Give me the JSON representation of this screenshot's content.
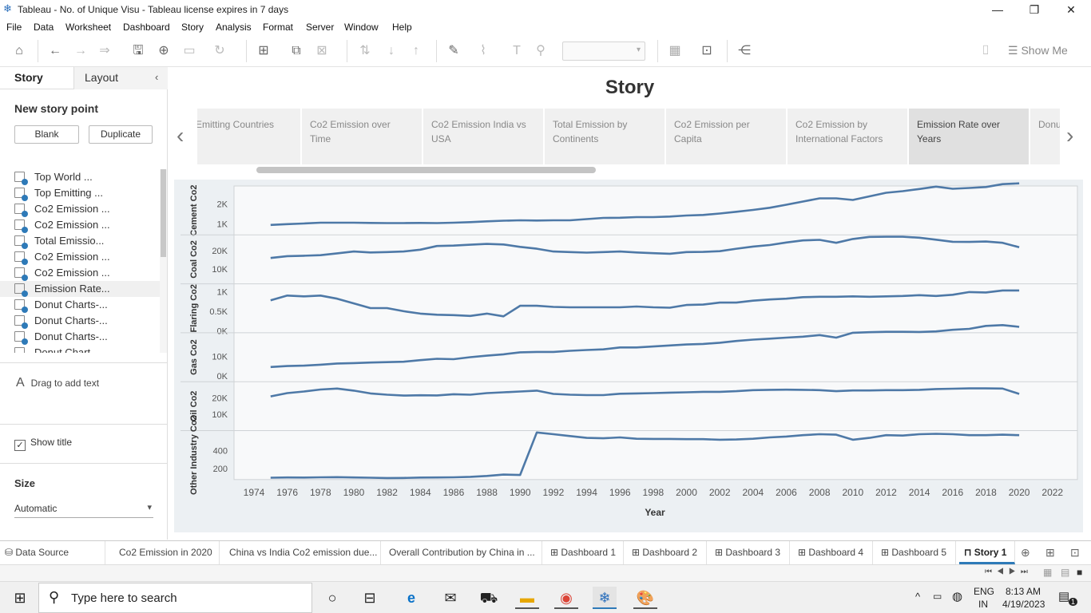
{
  "window": {
    "title": "Tableau - No. of Unique Visu - Tableau license expires in 7 days"
  },
  "menu": [
    "File",
    "Data",
    "Worksheet",
    "Dashboard",
    "Story",
    "Analysis",
    "Format",
    "Server",
    "Window",
    "Help"
  ],
  "toolbar": {
    "show_me": "Show Me"
  },
  "sidebar": {
    "tab_story": "Story",
    "tab_layout": "Layout",
    "new_story_point": "New story point",
    "blank_button": "Blank",
    "duplicate_button": "Duplicate",
    "sheets": [
      "Top World ...",
      "Top Emitting ...",
      "Co2 Emission ...",
      "Co2 Emission ...",
      "Total Emissio...",
      "Co2 Emission ...",
      "Co2 Emission ...",
      "Emission Rate...",
      "Donut Charts-...",
      "Donut Charts-...",
      "Donut Charts-...",
      "Donut Chart..."
    ],
    "drag_text": "Drag to add text",
    "show_title": "Show title",
    "size_label": "Size",
    "size_value": "Automatic"
  },
  "story": {
    "title": "Story",
    "points": [
      "Emitting Countries",
      "Co2 Emission over Time",
      "Co2 Emission India vs USA",
      "Total Emission by Continents",
      "Co2 Emission per Capita",
      "Co2 Emission by International Factors",
      "Emission Rate over Years",
      "Donut"
    ],
    "active_point": "Emission Rate over Years"
  },
  "chart_data": {
    "type": "line",
    "xlabel": "Year",
    "x_ticks": [
      "1974",
      "1976",
      "1978",
      "1980",
      "1982",
      "1984",
      "1986",
      "1988",
      "1990",
      "1992",
      "1994",
      "1996",
      "1998",
      "2000",
      "2002",
      "2004",
      "2006",
      "2008",
      "2010",
      "2012",
      "2014",
      "2016",
      "2018",
      "2020",
      "2022"
    ],
    "xlim": [
      1972.8,
      2023.5
    ],
    "years": [
      1975,
      1976,
      1977,
      1978,
      1979,
      1980,
      1981,
      1982,
      1983,
      1984,
      1985,
      1986,
      1987,
      1988,
      1989,
      1990,
      1991,
      1992,
      1993,
      1994,
      1995,
      1996,
      1997,
      1998,
      1999,
      2000,
      2001,
      2002,
      2003,
      2004,
      2005,
      2006,
      2007,
      2008,
      2009,
      2010,
      2011,
      2012,
      2013,
      2014,
      2015,
      2016,
      2017,
      2018,
      2019,
      2020
    ],
    "color": "#4e79a7",
    "panels": [
      {
        "name": "Cement Co2",
        "ticks": [
          {
            "v": 1000,
            "l": "1K"
          },
          {
            "v": 2000,
            "l": "2K"
          }
        ],
        "ylim": [
          450,
          2900
        ],
        "values": [
          950,
          990,
          1020,
          1060,
          1060,
          1060,
          1050,
          1040,
          1040,
          1050,
          1040,
          1060,
          1090,
          1130,
          1160,
          1180,
          1170,
          1180,
          1180,
          1240,
          1300,
          1310,
          1340,
          1340,
          1370,
          1420,
          1450,
          1520,
          1610,
          1700,
          1810,
          1960,
          2120,
          2280,
          2280,
          2200,
          2380,
          2560,
          2640,
          2750,
          2870,
          2760,
          2800,
          2850,
          2990,
          3030
        ]
      },
      {
        "name": "Coal Co2",
        "ticks": [
          {
            "v": 10000,
            "l": "10K"
          },
          {
            "v": 20000,
            "l": "20K"
          }
        ],
        "ylim": [
          2000,
          28500
        ],
        "values": [
          16000,
          17000,
          17200,
          17500,
          18500,
          19500,
          19000,
          19200,
          19500,
          20500,
          22500,
          22700,
          23200,
          23600,
          23300,
          22000,
          21000,
          19500,
          19200,
          18900,
          19200,
          19500,
          19000,
          18600,
          18300,
          19200,
          19300,
          19700,
          21000,
          22200,
          23000,
          24400,
          25500,
          25800,
          24200,
          26300,
          27400,
          27500,
          27500,
          27000,
          25900,
          24800,
          24700,
          24900,
          24200,
          21800
        ]
      },
      {
        "name": "Flaring Co2",
        "ticks": [
          {
            "v": 0,
            "l": "0K"
          },
          {
            "v": 500,
            "l": "0.5K"
          },
          {
            "v": 1000,
            "l": "1K"
          }
        ],
        "ylim": [
          -50,
          1200
        ],
        "values": [
          780,
          900,
          880,
          900,
          820,
          700,
          580,
          580,
          500,
          440,
          410,
          400,
          380,
          440,
          370,
          640,
          640,
          610,
          600,
          600,
          600,
          600,
          620,
          600,
          590,
          660,
          670,
          720,
          720,
          770,
          800,
          820,
          860,
          870,
          870,
          880,
          870,
          880,
          890,
          910,
          890,
          920,
          990,
          980,
          1030,
          1030
        ]
      },
      {
        "name": "Gas Co2",
        "ticks": [
          {
            "v": 0,
            "l": "0K"
          },
          {
            "v": 10000,
            "l": "10K"
          }
        ],
        "ylim": [
          -3000,
          22000
        ],
        "values": [
          4500,
          5000,
          5200,
          5700,
          6300,
          6500,
          6800,
          7000,
          7200,
          8000,
          8700,
          8500,
          9500,
          10300,
          11000,
          12000,
          12200,
          12200,
          12800,
          13200,
          13500,
          14500,
          14500,
          15000,
          15500,
          16000,
          16300,
          16900,
          17800,
          18500,
          19000,
          19500,
          20000,
          20800,
          19500,
          22000,
          22300,
          22500,
          22500,
          22400,
          22700,
          23500,
          24000,
          25500,
          25900,
          25000
        ]
      },
      {
        "name": "Oil Co2",
        "ticks": [
          {
            "v": 10000,
            "l": "10K"
          },
          {
            "v": 20000,
            "l": "20K"
          }
        ],
        "ylim": [
          0,
          30000
        ],
        "values": [
          21000,
          23000,
          24000,
          25200,
          25800,
          24500,
          22800,
          22000,
          21500,
          21700,
          21600,
          22300,
          22000,
          23000,
          23500,
          24000,
          24500,
          22500,
          22000,
          21800,
          21800,
          22600,
          22800,
          23000,
          23300,
          23500,
          23800,
          23800,
          24200,
          24800,
          25000,
          25100,
          25000,
          24800,
          24200,
          24600,
          24600,
          24800,
          24800,
          25000,
          25500,
          25700,
          25900,
          25900,
          25800,
          22500
        ]
      },
      {
        "name": "Other Industry Co2",
        "ticks": [
          {
            "v": 200,
            "l": "200"
          },
          {
            "v": 400,
            "l": "400"
          }
        ],
        "ylim": [
          80,
          620
        ],
        "values": [
          100,
          103,
          102,
          105,
          106,
          103,
          100,
          97,
          98,
          102,
          103,
          105,
          110,
          120,
          135,
          130,
          600,
          580,
          560,
          540,
          535,
          545,
          530,
          528,
          528,
          526,
          526,
          520,
          522,
          530,
          545,
          555,
          570,
          580,
          575,
          520,
          540,
          570,
          565,
          580,
          585,
          580,
          570,
          570,
          575,
          570
        ]
      }
    ]
  },
  "bottom_tabs": [
    "Data Source",
    "Co2 Emission in 2020",
    "China vs India Co2 emission due...",
    "Overall Contribution by China in ...",
    "Dashboard 1",
    "Dashboard 2",
    "Dashboard 3",
    "Dashboard 4",
    "Dashboard 5",
    "Story 1"
  ],
  "taskbar": {
    "search_placeholder": "Type here to search",
    "lang_top": "ENG",
    "lang_bottom": "IN",
    "time": "8:13 AM",
    "date": "4/19/2023",
    "notif_count": "1"
  }
}
